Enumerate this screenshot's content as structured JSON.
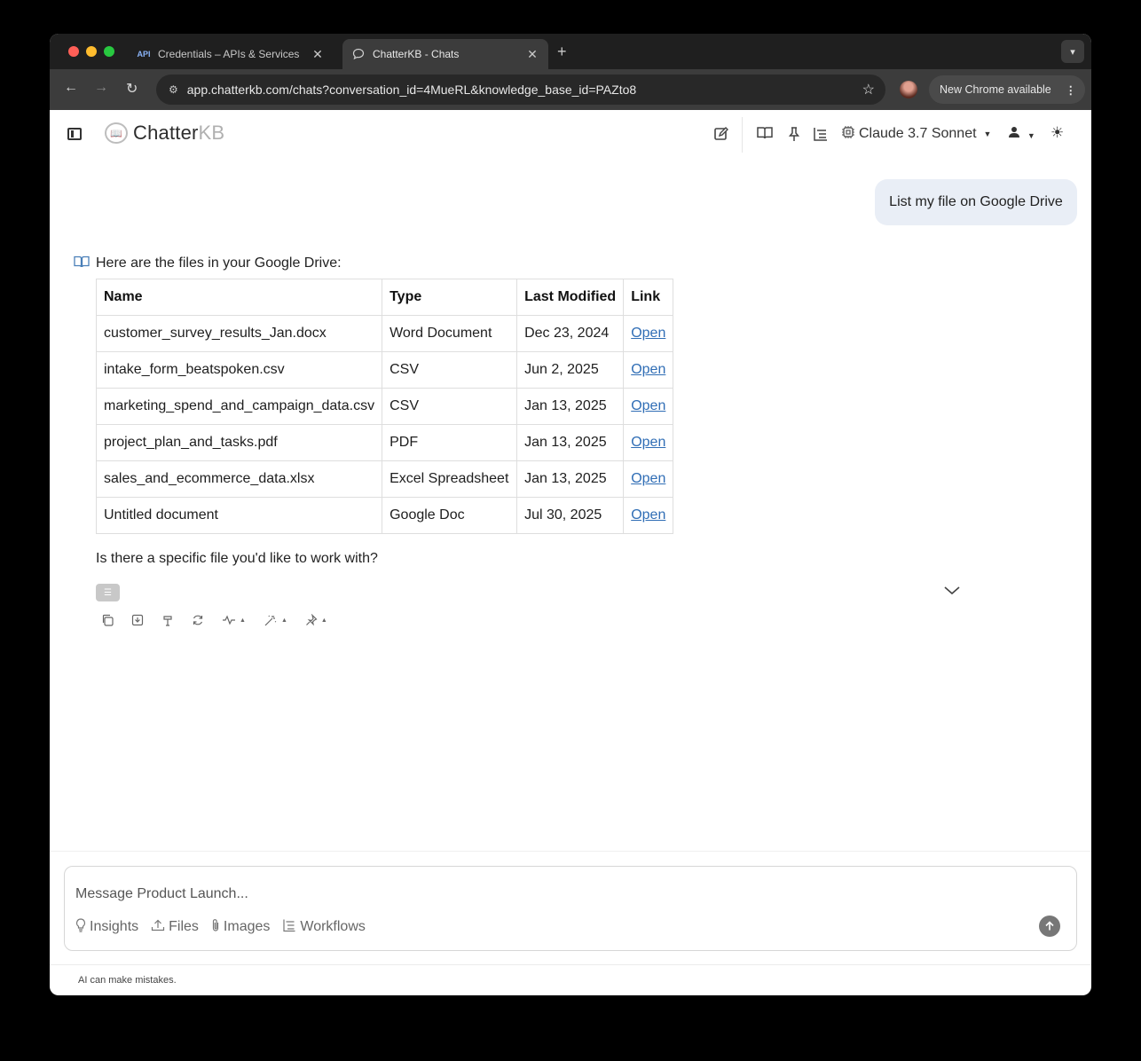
{
  "browser": {
    "tabs": [
      {
        "favicon": "API",
        "title": "Credentials – APIs & Services",
        "close": "✕",
        "active": false
      },
      {
        "favicon": "💬",
        "title": "ChatterKB - Chats",
        "close": "✕",
        "active": true
      }
    ],
    "new_tab": "+",
    "url": "app.chatterkb.com/chats?conversation_id=4MueRL&knowledge_base_id=PAZto8",
    "update_label": "New Chrome available"
  },
  "header": {
    "logo_main": "Chatter",
    "logo_accent": "KB",
    "model": "Claude 3.7 Sonnet"
  },
  "chat": {
    "user_message": "List my file on Google Drive",
    "assistant_intro": "Here are the files in your Google Drive:",
    "table": {
      "headers": [
        "Name",
        "Type",
        "Last Modified",
        "Link"
      ],
      "rows": [
        [
          "customer_survey_results_Jan.docx",
          "Word Document",
          "Dec 23, 2024",
          "Open"
        ],
        [
          "intake_form_beatspoken.csv",
          "CSV",
          "Jun 2, 2025",
          "Open"
        ],
        [
          "marketing_spend_and_campaign_data.csv",
          "CSV",
          "Jan 13, 2025",
          "Open"
        ],
        [
          "project_plan_and_tasks.pdf",
          "PDF",
          "Jan 13, 2025",
          "Open"
        ],
        [
          "sales_and_ecommerce_data.xlsx",
          "Excel Spreadsheet",
          "Jan 13, 2025",
          "Open"
        ],
        [
          "Untitled document",
          "Google Doc",
          "Jul 30, 2025",
          "Open"
        ]
      ]
    },
    "followup": "Is there a specific file you'd like to work with?"
  },
  "composer": {
    "placeholder": "Message Product Launch...",
    "tools": {
      "insights": "Insights",
      "files": "Files",
      "images": "Images",
      "workflows": "Workflows"
    }
  },
  "footer": {
    "disclaimer": "AI can make mistakes."
  }
}
